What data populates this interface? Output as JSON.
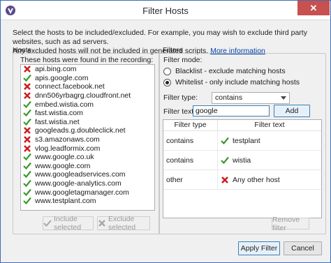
{
  "window": {
    "title": "Filter Hosts",
    "close_glyph": "✕"
  },
  "description": {
    "line1": "Select the hosts to be included/excluded. For example, you may wish to exclude third party websites, such as ad servers.",
    "line2": "Any excluded hosts will not be included in generated scripts.",
    "link": "More information"
  },
  "hosts_panel": {
    "label": "Hosts",
    "caption": "These hosts were found in the recording:",
    "items": [
      {
        "name": "api.bing.com",
        "status": "excluded"
      },
      {
        "name": "apis.google.com",
        "status": "included"
      },
      {
        "name": "connect.facebook.net",
        "status": "excluded"
      },
      {
        "name": "dnn506yrbagrg.cloudfront.net",
        "status": "excluded"
      },
      {
        "name": "embed.wistia.com",
        "status": "included"
      },
      {
        "name": "fast.wistia.com",
        "status": "included"
      },
      {
        "name": "fast.wistia.net",
        "status": "included"
      },
      {
        "name": "googleads.g.doubleclick.net",
        "status": "excluded"
      },
      {
        "name": "s3.amazonaws.com",
        "status": "excluded"
      },
      {
        "name": "vlog.leadformix.com",
        "status": "excluded"
      },
      {
        "name": "www.google.co.uk",
        "status": "included"
      },
      {
        "name": "www.google.com",
        "status": "included"
      },
      {
        "name": "www.googleadservices.com",
        "status": "included"
      },
      {
        "name": "www.google-analytics.com",
        "status": "included"
      },
      {
        "name": "www.googletagmanager.com",
        "status": "included"
      },
      {
        "name": "www.testplant.com",
        "status": "included"
      }
    ],
    "include_button": "Include selected",
    "exclude_button": "Exclude selected"
  },
  "filters_panel": {
    "label": "Filters",
    "mode_label": "Filter mode:",
    "blacklist_label": "Blacklist - exclude matching hosts",
    "whitelist_label": "Whitelist - only include matching hosts",
    "selected_mode": "whitelist",
    "type_label": "Filter type:",
    "type_value": "contains",
    "text_label": "Filter text:",
    "text_value": "google",
    "add_button": "Add",
    "columns": [
      "Filter type",
      "Filter text"
    ],
    "rows": [
      {
        "type": "contains",
        "text": "testplant",
        "status": "included"
      },
      {
        "type": "contains",
        "text": "wistia",
        "status": "included"
      },
      {
        "type": "other",
        "text": "Any other host",
        "status": "excluded"
      }
    ],
    "remove_button": "Remove filter"
  },
  "footer": {
    "apply_button": "Apply Filter",
    "cancel_button": "Cancel"
  },
  "colors": {
    "check": "#3a9a2a",
    "cross": "#cc1f1f",
    "accent": "#3c7fb1",
    "close": "#c75050"
  }
}
